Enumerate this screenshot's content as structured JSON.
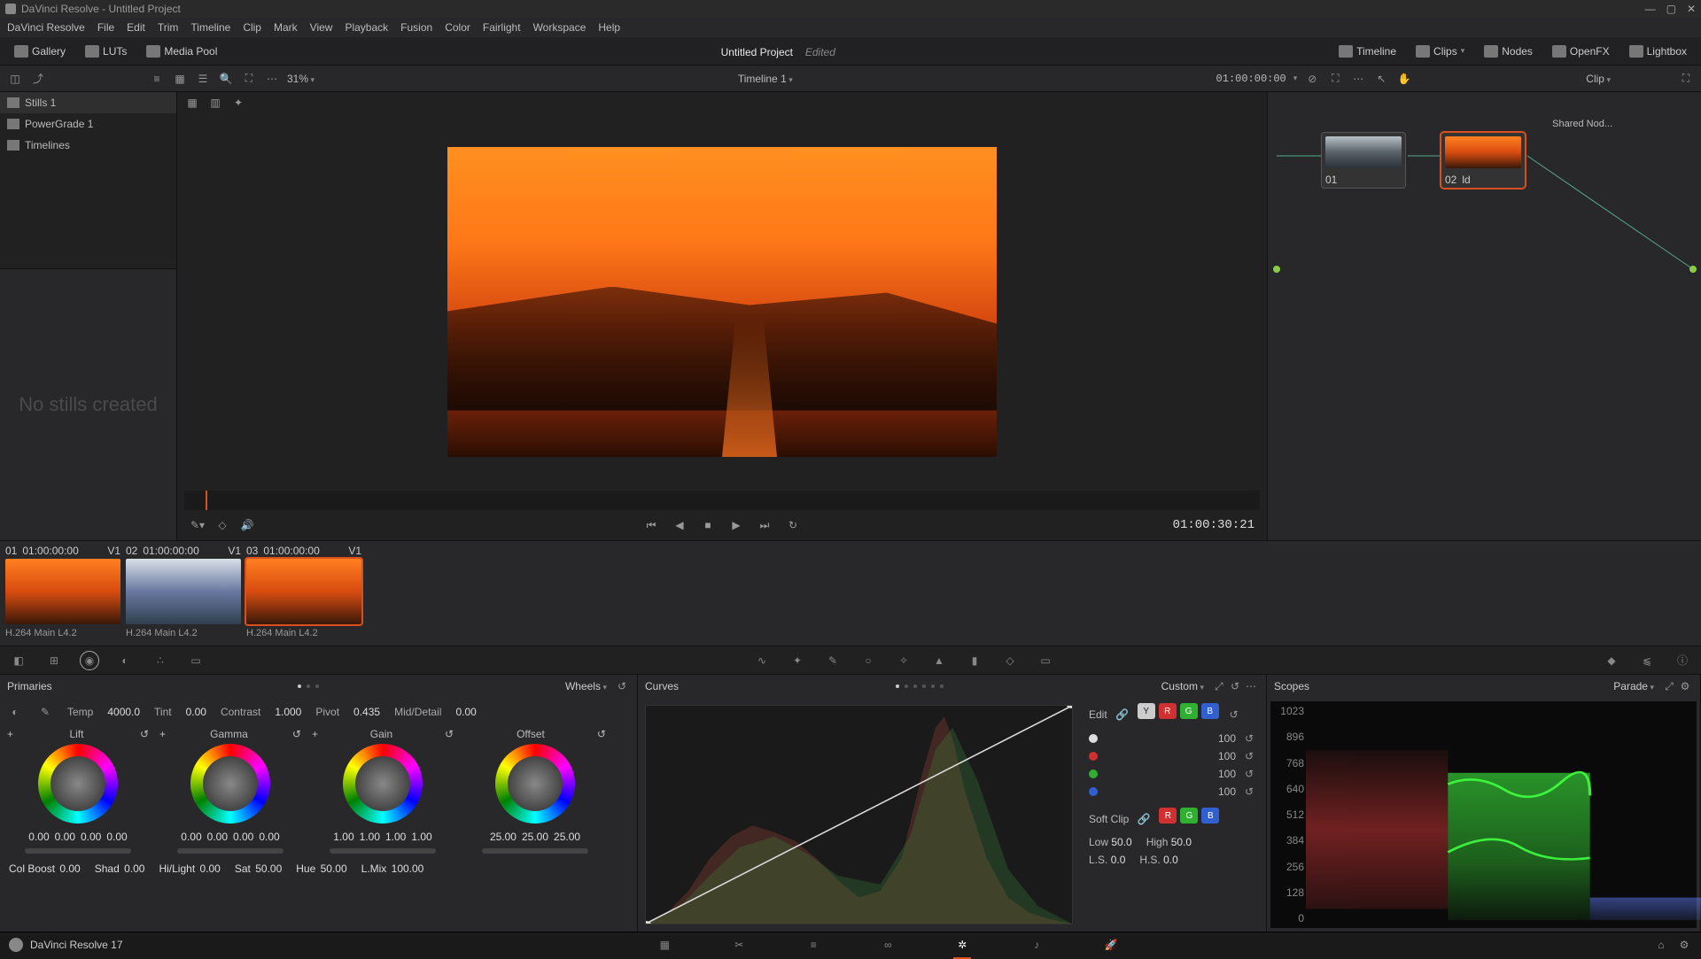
{
  "titlebar": {
    "text": "DaVinci Resolve - Untitled Project"
  },
  "menubar": [
    "DaVinci Resolve",
    "File",
    "Edit",
    "Trim",
    "Timeline",
    "Clip",
    "Mark",
    "View",
    "Playback",
    "Fusion",
    "Color",
    "Fairlight",
    "Workspace",
    "Help"
  ],
  "toolbar1": {
    "gallery": "Gallery",
    "luts": "LUTs",
    "mediapool": "Media Pool",
    "project": "Untitled Project",
    "edited": "Edited",
    "timeline": "Timeline",
    "clips": "Clips",
    "nodes": "Nodes",
    "openfx": "OpenFX",
    "lightbox": "Lightbox"
  },
  "toolbar2": {
    "zoom": "31%",
    "timeline_name": "Timeline 1",
    "timecode": "01:00:00:00",
    "right_mode": "Clip"
  },
  "left_tree": {
    "stills": "Stills 1",
    "powergrade": "PowerGrade 1",
    "timelines": "Timelines"
  },
  "stills_empty": "No stills created",
  "transport_tc": "01:00:30:21",
  "nodes": {
    "shared_label": "Shared Nod...",
    "n1": "01",
    "n2": "02",
    "n2b": "ld"
  },
  "clips": [
    {
      "num": "01",
      "tc": "01:00:00:00",
      "track": "V1",
      "codec": "H.264 Main L4.2",
      "style": "orange",
      "sel": false
    },
    {
      "num": "02",
      "tc": "01:00:00:00",
      "track": "V1",
      "codec": "H.264 Main L4.2",
      "style": "lake",
      "sel": false
    },
    {
      "num": "03",
      "tc": "01:00:00:00",
      "track": "V1",
      "codec": "H.264 Main L4.2",
      "style": "orange",
      "sel": true
    }
  ],
  "primaries": {
    "title": "Primaries",
    "mode": "Wheels",
    "temp_l": "Temp",
    "temp_v": "4000.0",
    "tint_l": "Tint",
    "tint_v": "0.00",
    "contrast_l": "Contrast",
    "contrast_v": "1.000",
    "pivot_l": "Pivot",
    "pivot_v": "0.435",
    "md_l": "Mid/Detail",
    "md_v": "0.00",
    "wheels": [
      {
        "name": "Lift",
        "v": [
          "0.00",
          "0.00",
          "0.00",
          "0.00"
        ]
      },
      {
        "name": "Gamma",
        "v": [
          "0.00",
          "0.00",
          "0.00",
          "0.00"
        ]
      },
      {
        "name": "Gain",
        "v": [
          "1.00",
          "1.00",
          "1.00",
          "1.00"
        ]
      },
      {
        "name": "Offset",
        "v": [
          "25.00",
          "25.00",
          "25.00"
        ]
      }
    ],
    "row2": {
      "colboost_l": "Col Boost",
      "colboost_v": "0.00",
      "shad_l": "Shad",
      "shad_v": "0.00",
      "hilight_l": "Hi/Light",
      "hilight_v": "0.00",
      "sat_l": "Sat",
      "sat_v": "50.00",
      "hue_l": "Hue",
      "hue_v": "50.00",
      "lmix_l": "L.Mix",
      "lmix_v": "100.00"
    }
  },
  "curves": {
    "title": "Curves",
    "mode": "Custom",
    "edit": "Edit",
    "chan_vals": [
      "100",
      "100",
      "100",
      "100"
    ],
    "softclip": "Soft Clip",
    "low_l": "Low",
    "low_v": "50.0",
    "high_l": "High",
    "high_v": "50.0",
    "ls_l": "L.S.",
    "ls_v": "0.0",
    "hs_l": "H.S.",
    "hs_v": "0.0"
  },
  "scopes": {
    "title": "Scopes",
    "mode": "Parade",
    "axis": [
      "1023",
      "896",
      "768",
      "640",
      "512",
      "384",
      "256",
      "128",
      "0"
    ]
  },
  "footer": {
    "app": "DaVinci Resolve 17"
  }
}
